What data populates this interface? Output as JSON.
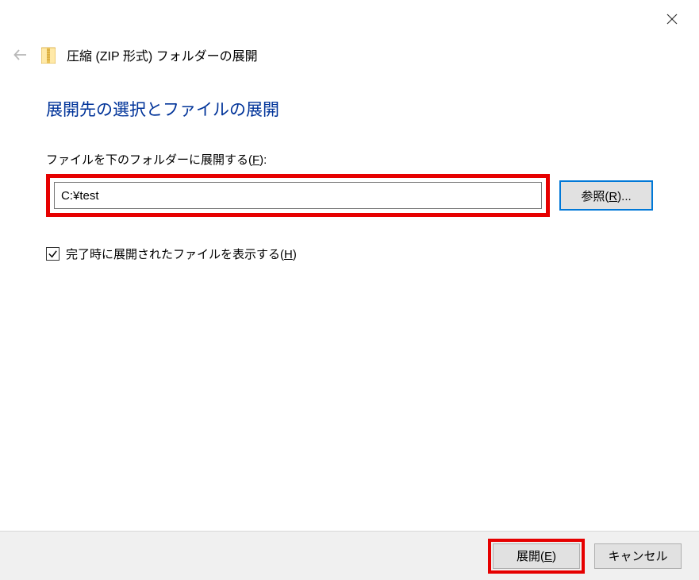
{
  "dialog": {
    "title": "圧縮 (ZIP 形式) フォルダーの展開",
    "heading": "展開先の選択とファイルの展開",
    "field_label_pre": "ファイルを下のフォルダーに展開する(",
    "field_label_key": "F",
    "field_label_post": "):",
    "path_value": "C:¥test",
    "browse_pre": "参照(",
    "browse_key": "R",
    "browse_post": ")...",
    "checkbox_checked": true,
    "checkbox_label_pre": "完了時に展開されたファイルを表示する(",
    "checkbox_label_key": "H",
    "checkbox_label_post": ")",
    "extract_pre": "展開(",
    "extract_key": "E",
    "extract_post": ")",
    "cancel_label": "キャンセル"
  }
}
